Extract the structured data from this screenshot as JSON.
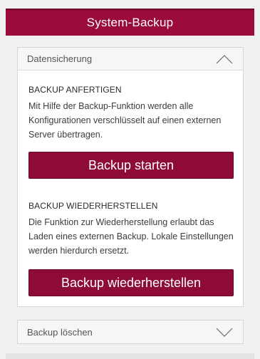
{
  "header": {
    "title": "System-Backup"
  },
  "panel_data_backup": {
    "heading": "Datensicherung",
    "chevron": "chevron-up-icon",
    "backup_create": {
      "title": "BACKUP ANFERTIGEN",
      "description": "Mit Hilfe der Backup-Funktion werden alle Konfigurationen verschlüsselt auf einen externen Server übertragen.",
      "button_label": "Backup starten"
    },
    "backup_restore": {
      "title": "BACKUP WIEDERHERSTELLEN",
      "description": "Die Funktion zur Wiederherstellung erlaubt das Laden eines externen Backup. Lokale Einstellungen werden hierdurch ersetzt.",
      "button_label": "Backup wiederherstellen"
    }
  },
  "panel_delete_backup": {
    "heading": "Backup löschen",
    "chevron": "chevron-down-icon"
  },
  "colors": {
    "accent": "#9b0a3c",
    "button": "#8e0a39",
    "background": "#f1f1f1"
  }
}
